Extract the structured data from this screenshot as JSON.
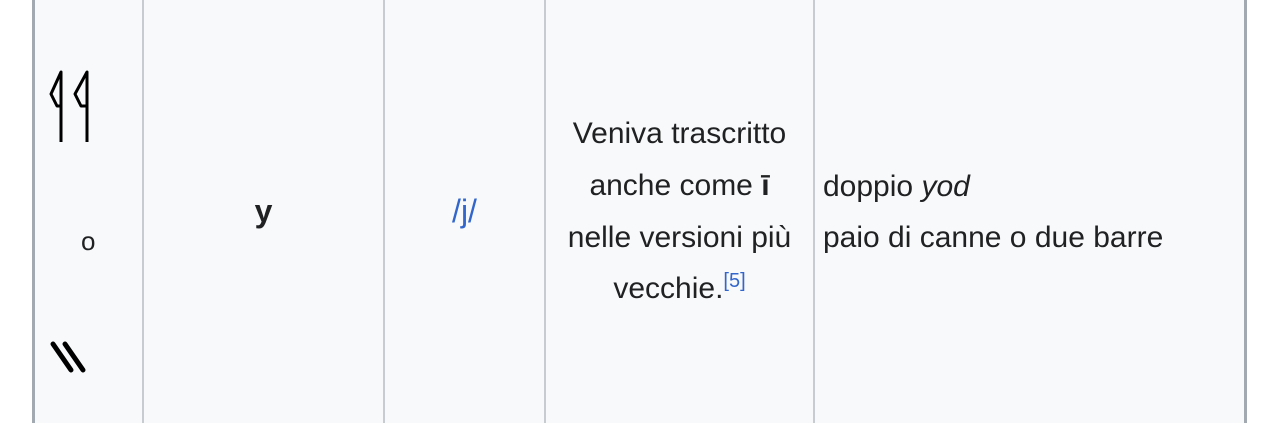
{
  "row": {
    "glyph_top": "double-reed-hieroglyph",
    "or_text": "o",
    "glyph_bottom": "double-stroke-hieroglyph",
    "transliteration": "y",
    "ipa": "/j/",
    "note": {
      "line1": "Veniva trascritto",
      "line2_prefix": "anche come ",
      "line2_letter": "ī",
      "line3": "nelle versioni più",
      "line4": "vecchie.",
      "ref": "[5]"
    },
    "meaning": {
      "line1_prefix": "doppio ",
      "line1_italic": "yod",
      "line2": "paio di canne o due barre"
    }
  },
  "colors": {
    "link": "#3366cc",
    "cell_bg": "#f8f9fa",
    "border": "#a2a9b1"
  }
}
